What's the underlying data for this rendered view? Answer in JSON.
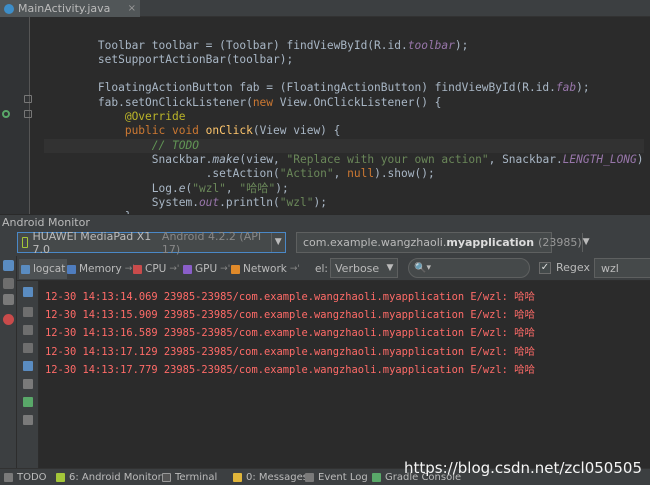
{
  "editor": {
    "tab_title": "MainActivity.java",
    "tab_close": "×",
    "code": {
      "l0": "Toolbar toolbar = (Toolbar) findViewById(R.id.",
      "l0_field": "toolbar",
      "l0_end": ");",
      "l1": "setSupportActionBar(toolbar);",
      "l3": "FloatingActionButton fab = (FloatingActionButton) findViewById(R.id.",
      "l3_field": "fab",
      "l3_end": ");",
      "l4_a": "fab.setOnClickListener(",
      "l4_new": "new",
      "l4_b": " View.OnClickListener() {",
      "l5": "@Override",
      "l6_pub": "public void",
      "l6_m": "onClick",
      "l6_b": "(View view) {",
      "l7": "// TODO",
      "l8_a": "Snackbar.",
      "l8_m": "make",
      "l8_b": "(view, ",
      "l8_s": "\"Replace with your own action\"",
      "l8_c": ", Snackbar.",
      "l8_f": "LENGTH_LONG",
      "l8_d": ")",
      "l9_a": ".setAction(",
      "l9_s": "\"Action\"",
      "l9_c": ", ",
      "l9_null": "null",
      "l9_d": ").show();",
      "l10_a": "Log.",
      "l10_m": "e",
      "l10_b": "(",
      "l10_s1": "\"wzl\"",
      "l10_c": ", ",
      "l10_s2": "\"哈哈\"",
      "l10_d": ");",
      "l11_a": "System.",
      "l11_f": "out",
      "l11_b": ".println(",
      "l11_s": "\"wzl\"",
      "l11_c": ");",
      "l12": "}",
      "l13": "});"
    }
  },
  "monitor": {
    "title": "Android Monitor",
    "device_name": "HUAWEI MediaPad X1 7.0",
    "device_detail": "Android 4.2.2 (API 17)",
    "device_arrow": "▼",
    "app_prefix": "com.example.wangzhaoli.",
    "app_bold": "myapplication",
    "app_pid": "(23985)",
    "app_arrow": "▼",
    "tabs": {
      "logcat": "logcat",
      "memory": "Memory",
      "cpu": "CPU",
      "gpu": "GPU",
      "network": "Network",
      "arrow": "→'"
    },
    "level_label": "el:",
    "level_value": "Verbose",
    "level_arrow": "▼",
    "search_icon": "🔍",
    "search_caret": "▾",
    "regex_label": "Regex",
    "regex_checked": "✓",
    "filter_value": "wzl",
    "log_lines": [
      "12-30 14:13:14.069 23985-23985/com.example.wangzhaoli.myapplication E/wzl: 哈哈",
      "12-30 14:13:15.909 23985-23985/com.example.wangzhaoli.myapplication E/wzl: 哈哈",
      "12-30 14:13:16.589 23985-23985/com.example.wangzhaoli.myapplication E/wzl: 哈哈",
      "12-30 14:13:17.129 23985-23985/com.example.wangzhaoli.myapplication E/wzl: 哈哈",
      "12-30 14:13:17.779 23985-23985/com.example.wangzhaoli.myapplication E/wzl: 哈哈"
    ]
  },
  "statusbar": {
    "todo": "TODO",
    "android_monitor": "6: Android Monitor",
    "terminal": "Terminal",
    "messages": "0: Messages",
    "event_log": "Event Log",
    "gradle_console": "Gradle Console"
  },
  "watermark": "https://blog.csdn.net/zcl050505",
  "colors": {
    "log_error": "#ff6b68",
    "background": "#2b2b2b",
    "panel": "#3c3f41"
  }
}
